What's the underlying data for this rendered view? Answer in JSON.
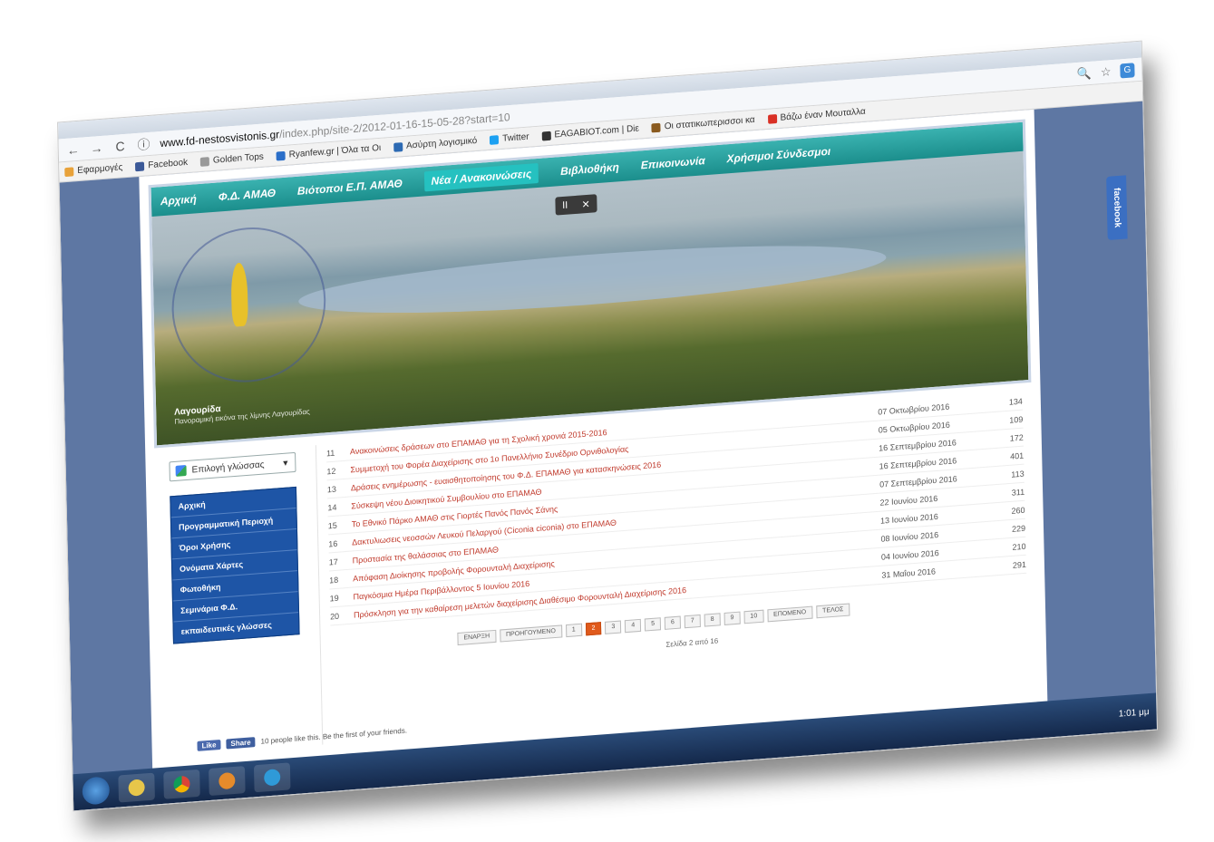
{
  "browser": {
    "url_host": "www.fd-nestosvistonis.gr",
    "url_path": "/index.php/site-2/2012-01-16-15-05-28?start=10",
    "nav": {
      "back": "←",
      "forward": "→",
      "reload": "C",
      "info": "ⓘ"
    },
    "tools": {
      "zoom": "🔍",
      "star": "☆",
      "ext": "G"
    },
    "bookmarks": [
      {
        "label": "Εφαρμογές",
        "color": "#e8a23a"
      },
      {
        "label": "Facebook",
        "color": "#3b5998"
      },
      {
        "label": "Golden Tops",
        "color": "#999999"
      },
      {
        "label": "Ryanfew.gr | Όλα τα Οι",
        "color": "#2b6fc9"
      },
      {
        "label": "Ασύρτη λογισμικό",
        "color": "#2d6ab3"
      },
      {
        "label": "Twitter",
        "color": "#1da1f2"
      },
      {
        "label": "EAGABIOT.com | Diε",
        "color": "#333333"
      },
      {
        "label": "Οι στατικωπερισσοι κα",
        "color": "#8a5a1e"
      },
      {
        "label": "Βάζω έναν Μουταλλα",
        "color": "#d93025"
      }
    ]
  },
  "site": {
    "menu": [
      {
        "label": "Αρχική",
        "active": false
      },
      {
        "label": "Φ.Δ. ΑΜΑΘ",
        "active": false
      },
      {
        "label": "Βιότοποι Ε.Π. ΑΜΑΘ",
        "active": false
      },
      {
        "label": "Νέα / Ανακοινώσεις",
        "active": true
      },
      {
        "label": "Βιβλιοθήκη",
        "active": false
      },
      {
        "label": "Επικοινωνία",
        "active": false
      },
      {
        "label": "Χρήσιμοι Σύνδεσμοι",
        "active": false
      }
    ],
    "slider": {
      "pause": "II",
      "close": "✕"
    },
    "caption": {
      "title": "Λαγουρίδα",
      "subtitle": "Πανοραμική εικόνα της λίμνης Λαγουρίδας"
    },
    "facebook_tab": "facebook",
    "language_select": "Επιλογή γλώσσας",
    "sidebar": [
      "Αρχική",
      "Προγραμματική Περιοχή",
      "Όροι Χρήσης",
      "Ονόματα Χάρτες",
      "Φωτοθήκη",
      "Σεμινάρια Φ.Δ.",
      "εκπαιδευτικές γλώσσες"
    ],
    "articles": [
      {
        "num": "11",
        "title": "Ανακοινώσεις δράσεων στο ΕΠΑΜΑΘ για τη Σχολική χρονιά 2015-2016",
        "date": "07 Οκτωβρίου 2016",
        "hits": "134"
      },
      {
        "num": "12",
        "title": "Συμμετοχή του Φορέα Διαχείρισης στο 1ο Πανελλήνιο Συνέδριο Ορνιθολογίας",
        "date": "05 Οκτωβρίου 2016",
        "hits": "109"
      },
      {
        "num": "13",
        "title": "Δράσεις ενημέρωσης - ευαισθητοποίησης του Φ.Δ. ΕΠΑΜΑΘ για κατασκηνώσεις 2016",
        "date": "16 Σεπτεμβρίου 2016",
        "hits": "172"
      },
      {
        "num": "14",
        "title": "Σύσκεψη νέου Διοικητικού Συμβουλίου στο ΕΠΑΜΑΘ",
        "date": "16 Σεπτεμβρίου 2016",
        "hits": "401"
      },
      {
        "num": "15",
        "title": "Το Εθνικό Πάρκο ΑΜΑΘ στις Γιορτές Πανός Πανός Σάνης",
        "date": "07 Σεπτεμβρίου 2016",
        "hits": "113"
      },
      {
        "num": "16",
        "title": "Δακτυλιωσεις νεοσσών Λευκού Πελαργού (Ciconia ciconia) στο ΕΠΑΜΑΘ",
        "date": "22 Ιουνίου 2016",
        "hits": "311"
      },
      {
        "num": "17",
        "title": "Προστασία της θαλάσσιας στο ΕΠΑΜΑΘ",
        "date": "13 Ιουνίου 2016",
        "hits": "260"
      },
      {
        "num": "18",
        "title": "Απόφαση Διοίκησης προβολής Φορουνταλή Διαχείρισης",
        "date": "08 Ιουνίου 2016",
        "hits": "229"
      },
      {
        "num": "19",
        "title": "Παγκόσμια Ημέρα Περιβάλλοντος 5 Ιουνίου 2016",
        "date": "04 Ιουνίου 2016",
        "hits": "210"
      },
      {
        "num": "20",
        "title": "Πρόσκληση για την καθαίρεση μελετών διαχείρισης Διαθέσιμο Φορουνταλή Διαχείρισης 2016",
        "date": "31 Μαΐου 2016",
        "hits": "291"
      }
    ],
    "pagination": {
      "first": "ΕΝΑΡΞΗ",
      "prev": "ΠΡΟΗΓΟΥΜΕΝΟ",
      "pages": [
        "1",
        "2",
        "3",
        "4",
        "5",
        "6",
        "7",
        "8",
        "9",
        "10"
      ],
      "current": "2",
      "next": "ΕΠΟΜΕΝΟ",
      "last": "ΤΕΛΟΣ",
      "info": "Σελίδα 2 από 16"
    },
    "social": {
      "like": "Like",
      "share": "Share",
      "text": "10 people like this. Be the first of your friends."
    }
  },
  "taskbar": {
    "clock": "1:01 μμ"
  }
}
